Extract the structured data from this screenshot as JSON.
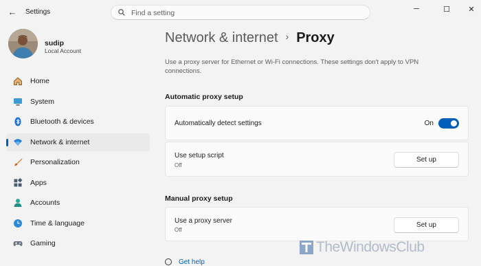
{
  "window": {
    "title": "Settings",
    "minimize": "─",
    "maximize": "☐",
    "close": "✕",
    "back": "←"
  },
  "search": {
    "placeholder": "Find a setting"
  },
  "profile": {
    "name": "sudip",
    "account": "Local Account"
  },
  "nav": {
    "items": [
      {
        "label": "Home",
        "icon": "home-icon"
      },
      {
        "label": "System",
        "icon": "monitor-icon"
      },
      {
        "label": "Bluetooth & devices",
        "icon": "bluetooth-icon"
      },
      {
        "label": "Network & internet",
        "icon": "wifi-icon",
        "active": true
      },
      {
        "label": "Personalization",
        "icon": "brush-icon"
      },
      {
        "label": "Apps",
        "icon": "apps-icon"
      },
      {
        "label": "Accounts",
        "icon": "person-icon"
      },
      {
        "label": "Time & language",
        "icon": "globe-clock-icon"
      },
      {
        "label": "Gaming",
        "icon": "gamepad-icon"
      }
    ]
  },
  "breadcrumb": {
    "parent": "Network & internet",
    "separator": "›",
    "current": "Proxy"
  },
  "description": "Use a proxy server for Ethernet or Wi-Fi connections. These settings don't apply to VPN connections.",
  "automatic": {
    "heading": "Automatic proxy setup",
    "detect": {
      "label": "Automatically detect settings",
      "state": "On"
    },
    "script": {
      "label": "Use setup script",
      "status": "Off",
      "button": "Set up"
    }
  },
  "manual": {
    "heading": "Manual proxy setup",
    "proxy": {
      "label": "Use a proxy server",
      "status": "Off",
      "button": "Set up"
    }
  },
  "help": {
    "label": "Get help"
  },
  "watermark": {
    "text": "TheWindowsClub"
  },
  "colors": {
    "accent": "#005fb8",
    "background": "#f3f3f3",
    "card": "#fbfbfb"
  }
}
